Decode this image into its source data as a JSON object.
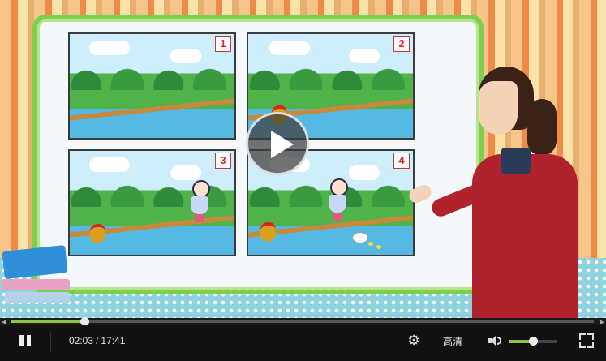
{
  "video": {
    "panel_numbers": [
      "1",
      "2",
      "3",
      "4"
    ]
  },
  "controls": {
    "current_time": "02:03",
    "separator": "/",
    "duration": "17:41",
    "quality_label": "高清",
    "progress_fraction": 0.125,
    "volume_fraction": 0.5,
    "accent_color": "#8cc34a",
    "icons": [
      "pause-icon",
      "gear-icon",
      "volume-icon",
      "fullscreen-icon",
      "play-icon"
    ]
  }
}
